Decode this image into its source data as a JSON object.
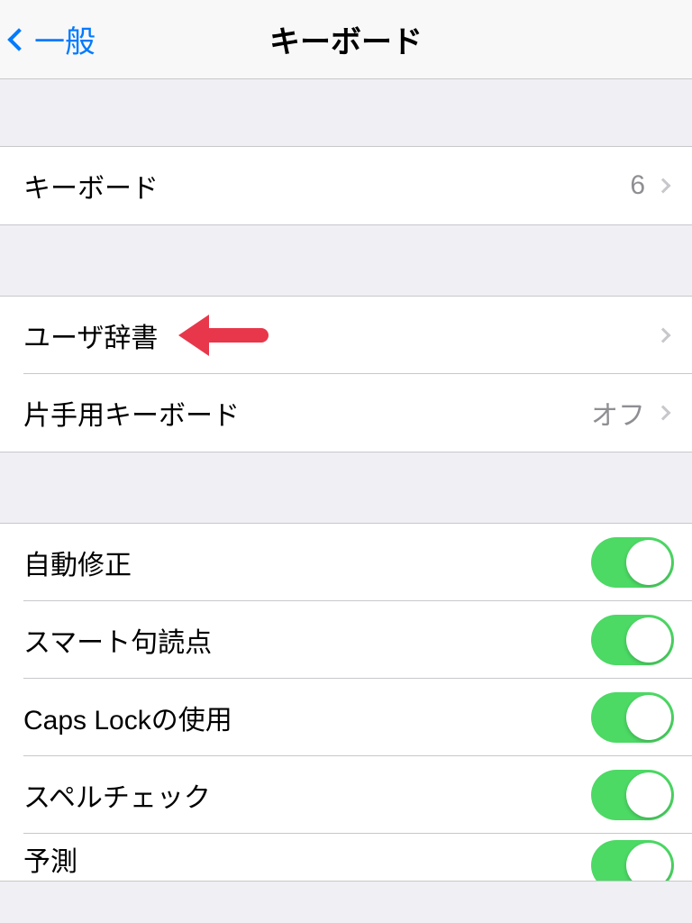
{
  "navbar": {
    "back_label": "一般",
    "title": "キーボード"
  },
  "sections": {
    "keyboards": {
      "label": "キーボード",
      "count": "6"
    },
    "user_dict": {
      "label": "ユーザ辞書"
    },
    "one_handed": {
      "label": "片手用キーボード",
      "value": "オフ"
    },
    "toggles": [
      {
        "label": "自動修正",
        "on": true
      },
      {
        "label": "スマート句読点",
        "on": true
      },
      {
        "label": "Caps Lockの使用",
        "on": true
      },
      {
        "label": "スペルチェック",
        "on": true
      },
      {
        "label": "予測",
        "on": true
      }
    ]
  },
  "annotation": {
    "arrow_color": "#e8374a"
  }
}
